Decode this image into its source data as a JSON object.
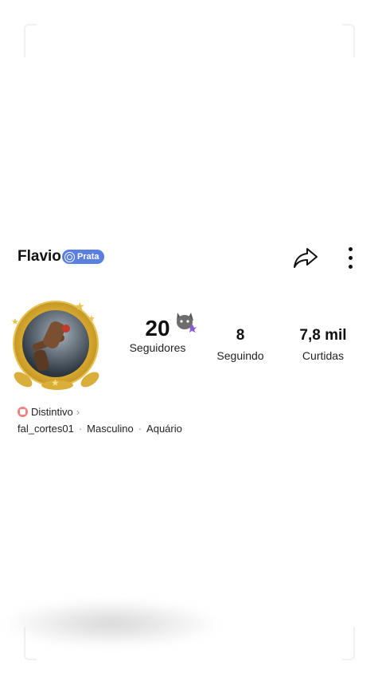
{
  "profile": {
    "name": "Flavio",
    "tier": "Prata",
    "stats": {
      "followers": {
        "value": "20",
        "label": "Seguidores"
      },
      "following": {
        "value": "8",
        "label": "Seguindo"
      },
      "likes": {
        "value": "7,8 mil",
        "label": "Curtidas"
      }
    },
    "badge_label": "Distintivo",
    "username": "fal_cortes01",
    "gender": "Masculino",
    "sign": "Aquário",
    "separator": "·"
  },
  "icons": {
    "share": "share-icon",
    "more": "more-vertical-icon",
    "tier": "tier-badge-icon",
    "badge": "badge-icon",
    "chevron": "chevron-right-icon"
  },
  "colors": {
    "tier_badge": "#5b7fe0",
    "gold_frame": "#d4a52c",
    "badge_icon": "#f08080"
  }
}
